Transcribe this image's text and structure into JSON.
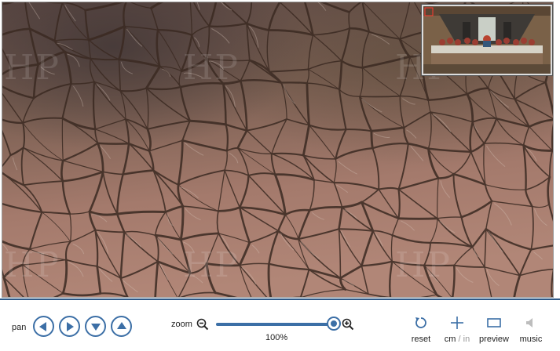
{
  "viewer": {
    "watermark_text": "HP"
  },
  "toolbar": {
    "pan": {
      "label": "pan",
      "left_icon": "arrow-left-icon",
      "right_icon": "arrow-right-icon",
      "down_icon": "arrow-down-icon",
      "up_icon": "arrow-up-icon"
    },
    "zoom": {
      "label": "zoom",
      "value_text": "100%",
      "level": 1.0,
      "zoom_out_icon": "zoom-out-icon",
      "zoom_in_icon": "zoom-in-icon"
    },
    "reset": {
      "label": "reset",
      "icon": "reset-icon"
    },
    "units": {
      "active": "cm",
      "separator": " / ",
      "inactive": "in",
      "icon": "crosshair-icon"
    },
    "preview": {
      "label": "preview",
      "icon": "preview-rectangle-icon"
    },
    "music": {
      "label": "music",
      "icon": "speaker-icon"
    }
  },
  "colors": {
    "accent": "#3c6fa6",
    "divider": "#2e5a88",
    "disabled": "#999999"
  }
}
